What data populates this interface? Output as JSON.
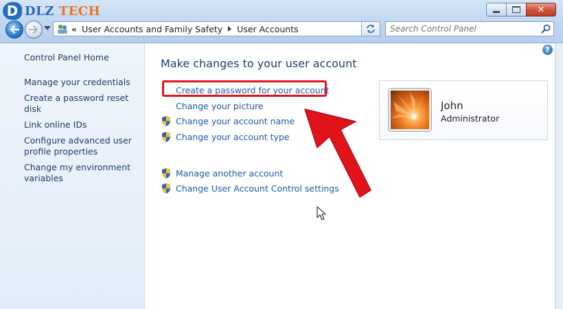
{
  "logo": {
    "mark": "D",
    "text_brand": "DLZ",
    "text_rest": "TECH"
  },
  "window": {
    "minimize_icon": "minimize-icon",
    "maximize_icon": "maximize-icon",
    "close_icon": "close-icon",
    "close_glyph": "✕"
  },
  "navigation": {
    "back_icon": "back-arrow-icon",
    "forward_icon": "forward-arrow-icon"
  },
  "address": {
    "overflow": "«",
    "crumbs": [
      "User Accounts and Family Safety",
      "User Accounts"
    ]
  },
  "search": {
    "placeholder": "Search Control Panel"
  },
  "left_pane": {
    "home": "Control Panel Home",
    "links": [
      "Manage your credentials",
      "Create a password reset disk",
      "Link online IDs",
      "Configure advanced user profile properties",
      "Change my environment variables"
    ]
  },
  "main": {
    "help_glyph": "?",
    "title": "Make changes to your user account",
    "tasks": [
      {
        "label": "Create a password for your account",
        "shield": false
      },
      {
        "label": "Change your picture",
        "shield": false
      },
      {
        "label": "Change your account name",
        "shield": true
      },
      {
        "label": "Change your account type",
        "shield": true
      }
    ],
    "other_tasks": [
      {
        "label": "Manage another account",
        "shield": true
      },
      {
        "label": "Change User Account Control settings",
        "shield": true
      }
    ]
  },
  "user": {
    "name": "John",
    "role": "Administrator"
  },
  "colors": {
    "link": "#1d5aa8",
    "highlight": "#e0131a",
    "title": "#1e3f6e",
    "logo_orange": "#f0721e",
    "logo_blue": "#2c65b9"
  }
}
